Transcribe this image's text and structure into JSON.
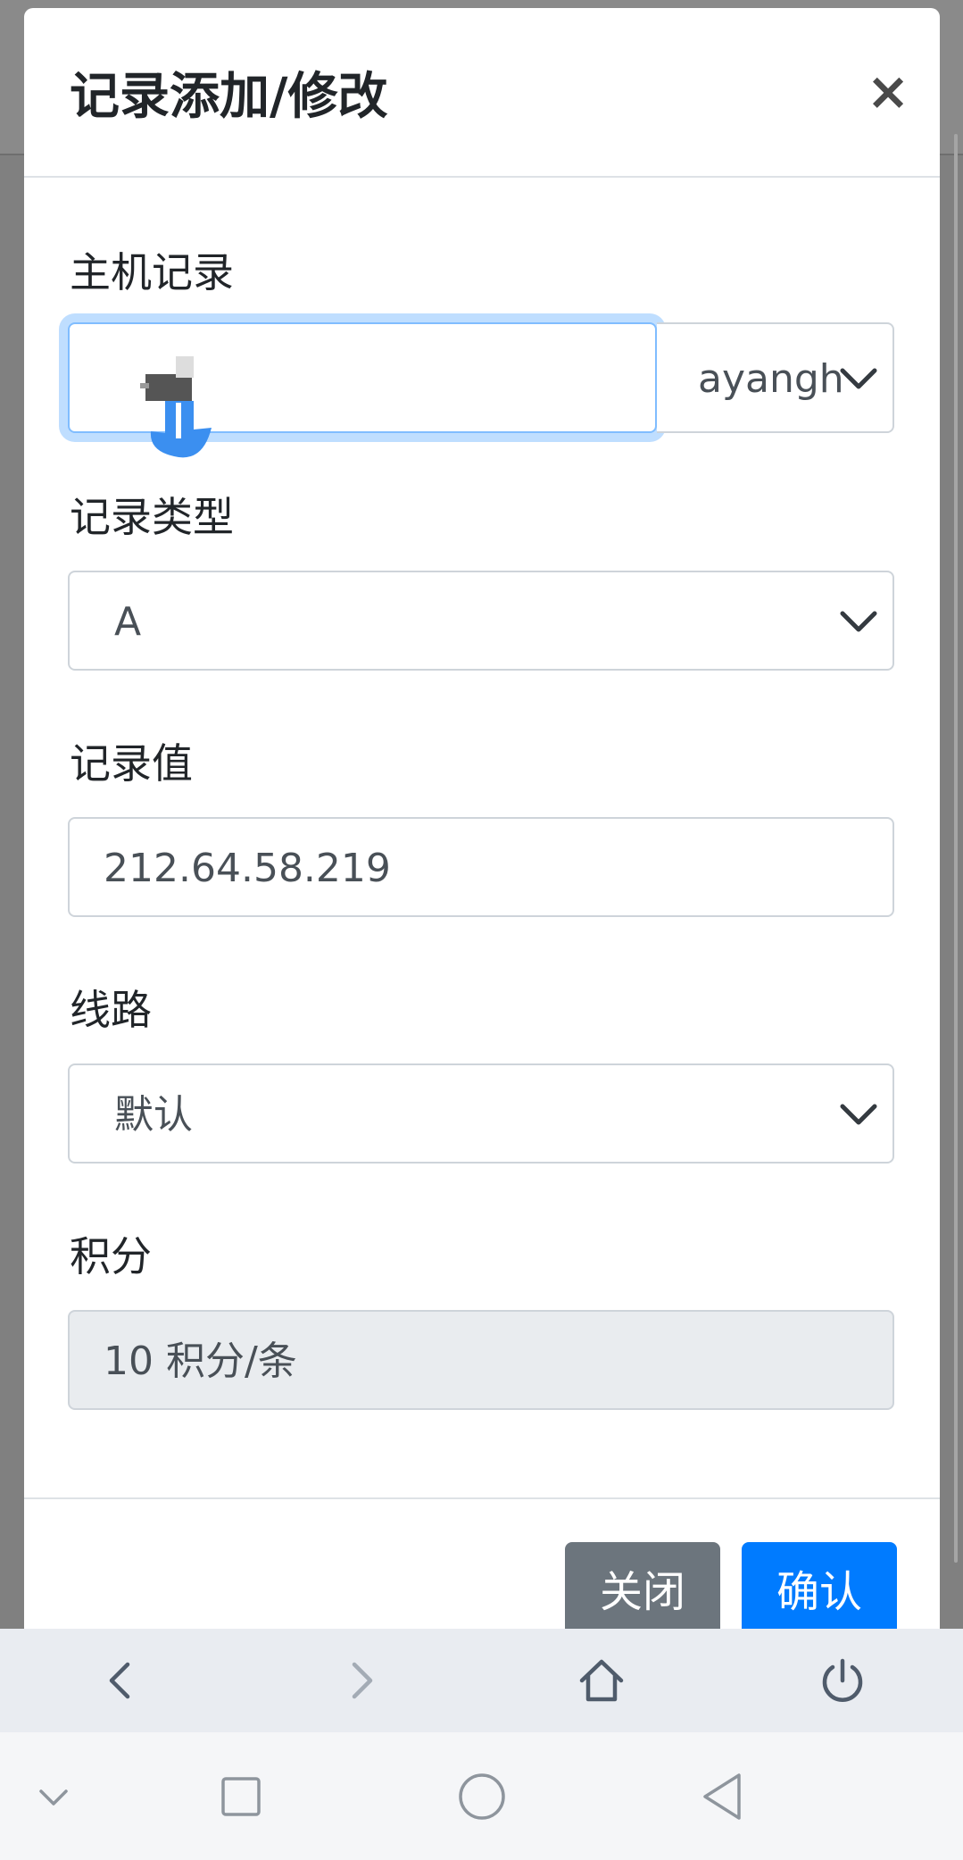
{
  "modal": {
    "title": "记录添加/修改",
    "close_symbol": "×"
  },
  "host_record": {
    "label": "主机记录",
    "value": "",
    "domain_value": "ayangh"
  },
  "record_type": {
    "label": "记录类型",
    "value": "A"
  },
  "record_value": {
    "label": "记录值",
    "value": "212.64.58.219"
  },
  "line": {
    "label": "线路",
    "value": "默认"
  },
  "points": {
    "label": "积分",
    "value": "10 积分/条"
  },
  "buttons": {
    "close": "关闭",
    "confirm": "确认"
  },
  "browser_bar": {
    "icons": [
      "back-icon",
      "forward-icon",
      "home-icon",
      "power-icon"
    ]
  },
  "system_nav": {
    "icons": [
      "collapse-icon",
      "recents-icon",
      "home-circle-icon",
      "back-triangle-icon"
    ]
  },
  "colors": {
    "primary": "#007bff",
    "secondary": "#6c757d",
    "focus_border": "#80bdff",
    "disabled_bg": "#e9ecef"
  }
}
